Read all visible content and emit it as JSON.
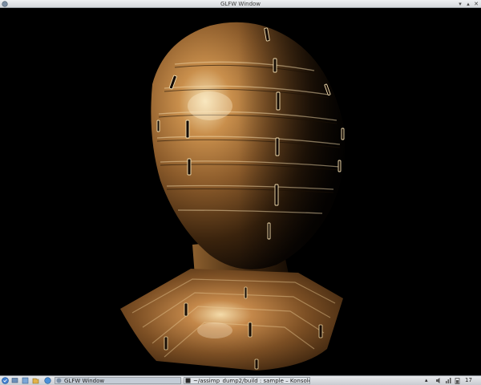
{
  "window": {
    "title": "GLFW Window"
  },
  "icons": {
    "app": "glfw-window-icon",
    "minimize": "minimize-icon",
    "maximize": "maximize-icon",
    "close": "close-icon",
    "start": "kde-menu-icon",
    "show_desktop": "show-desktop-icon",
    "file_manager": "file-manager-icon",
    "browser": "browser-icon",
    "volume": "volume-icon",
    "network": "network-icon",
    "battery": "battery-icon",
    "tray_expand": "tray-expand-icon"
  },
  "scene": {
    "description_model": "textured helmet model",
    "colors": {
      "background": "#000000",
      "material_base": "#8a5a2a",
      "highlight": "#f1d8a5",
      "shadow": "#140b03"
    }
  },
  "taskbar": {
    "tasks": [
      {
        "label": "GLFW Window",
        "active": true
      },
      {
        "label": "~/assimp_dump2/build : sample – Konsole",
        "active": false
      }
    ],
    "clock": "17"
  }
}
